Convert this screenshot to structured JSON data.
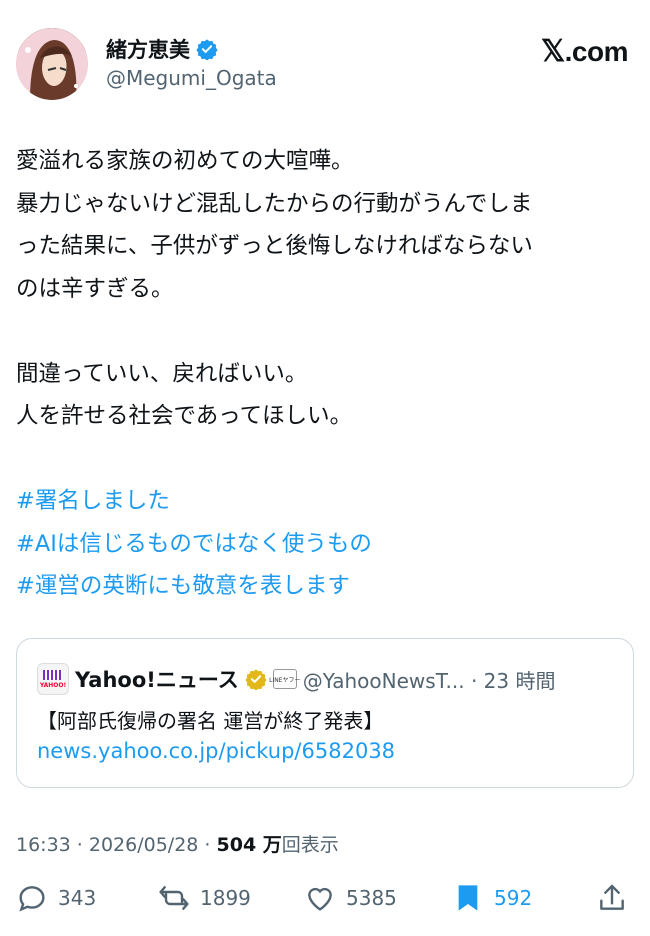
{
  "author": {
    "display_name": "緒方恵美",
    "handle": "@Megumi_Ogata",
    "avatar": "avatar-illustration",
    "verified": "verified-badge-icon"
  },
  "brand": {
    "logo_text": ".com",
    "logo_icon": "x-logo-icon"
  },
  "tweet": {
    "lines": [
      "愛溢れる家族の初めての大喧嘩。",
      "暴力じゃないけど混乱したからの行動がうんでしま",
      "った結果に、子供がずっと後悔しなければならない",
      "のは辛すぎる。",
      "間違っていい、戻ればいい。",
      "人を許せる社会であってほしい。"
    ],
    "hashtags": [
      "#署名しました",
      "#AIは信じるものではなく使うもの",
      "#運営の英断にも敬意を表します"
    ]
  },
  "quote": {
    "name": "Yahoo!ニュース",
    "handle_time": "@YahooNewsT... · 23 時間",
    "line_badge": "LINEヤフー",
    "title": "【阿部氏復帰の署名 運営が終了発表】",
    "link": "news.yahoo.co.jp/pickup/6582038"
  },
  "meta": {
    "time": "16:33 · 2026/05/28 · ",
    "views_count": "504 万",
    "views_label": "回表示"
  },
  "actions": {
    "replies": "343",
    "retweets": "1899",
    "likes": "5385",
    "bookmarks": "592"
  },
  "colors": {
    "link": "#1d9bf0",
    "secondary": "#536471",
    "text": "#0f1419"
  }
}
